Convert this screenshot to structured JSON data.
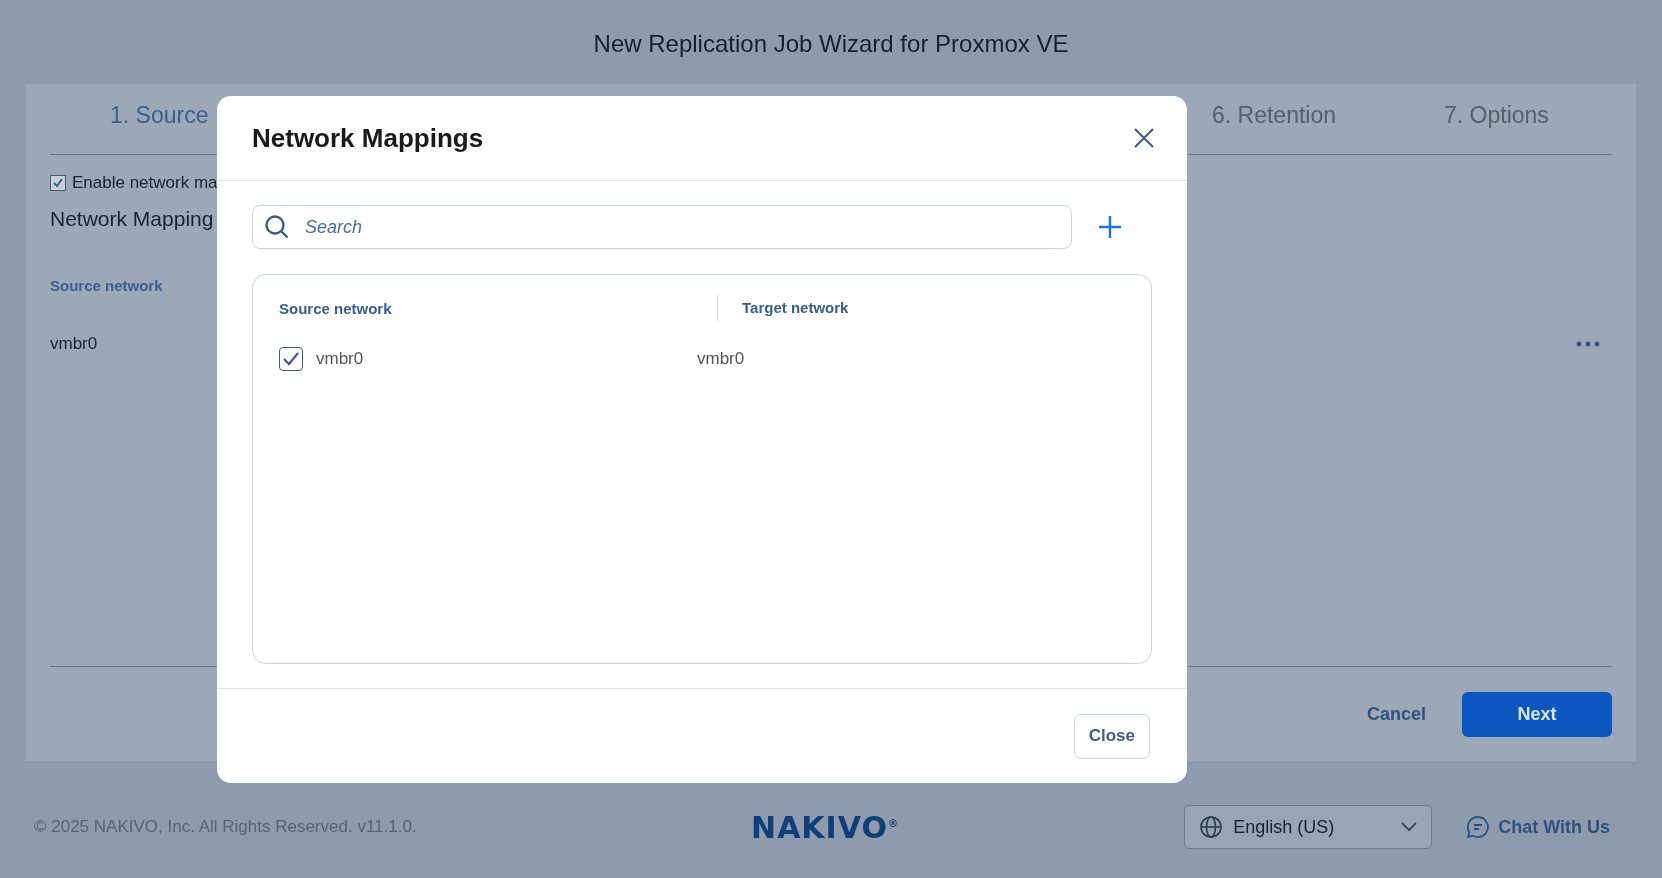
{
  "page_title": "New Replication Job Wizard for Proxmox VE",
  "steps": [
    {
      "label": "1. Source",
      "completed": true
    },
    {
      "label": "6. Retention",
      "completed": false
    },
    {
      "label": "7. Options",
      "completed": false
    }
  ],
  "enable_network_mapping": {
    "label": "Enable network ma",
    "checked": true
  },
  "section_title": "Network Mapping",
  "background_table": {
    "columns": [
      "Source network"
    ],
    "rows": [
      {
        "source": "vmbr0"
      }
    ]
  },
  "wizard_buttons": {
    "cancel": "Cancel",
    "next": "Next"
  },
  "footer": {
    "copyright": "© 2025 NAKIVO, Inc. All Rights Reserved. v11.1.0.",
    "logo": "NAKIVO",
    "logo_mark": "®",
    "language": "English (US)",
    "chat": "Chat With Us"
  },
  "dialog": {
    "title": "Network Mappings",
    "search": {
      "placeholder": "Search"
    },
    "columns": [
      "Source network",
      "Target network"
    ],
    "rows": [
      {
        "source": "vmbr0",
        "target": "vmbr0",
        "checked": true
      }
    ],
    "close_button": "Close"
  }
}
